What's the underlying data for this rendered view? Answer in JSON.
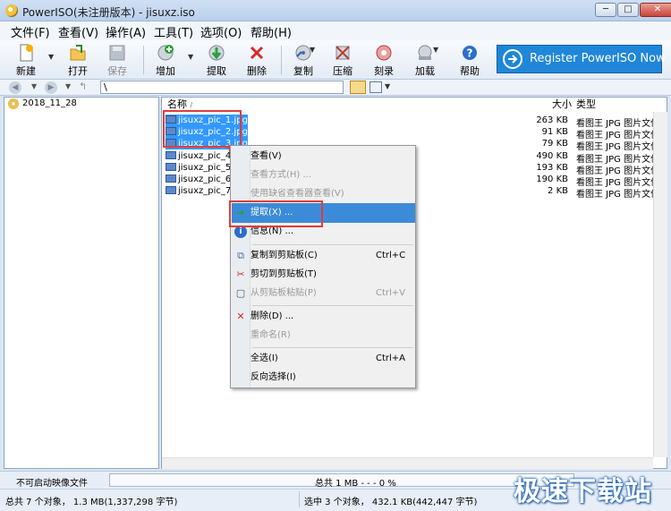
{
  "window": {
    "title": "PowerISO(未注册版本) - jisuxz.iso",
    "buttons": {
      "minimize": "─",
      "maximize": "□",
      "close": "✕"
    }
  },
  "menu": [
    "文件(F)",
    "查看(V)",
    "操作(A)",
    "工具(T)",
    "选项(O)",
    "帮助(H)"
  ],
  "toolbar": {
    "new": "新建",
    "open": "打开",
    "save": "保存",
    "add": "增加",
    "extract": "提取",
    "delete": "删除",
    "copy": "复制",
    "compress": "压缩",
    "burn": "刻录",
    "mount": "加载",
    "help": "帮助",
    "register": "Register PowerISO Now"
  },
  "address": {
    "path": "\\"
  },
  "tree": {
    "root": "2018_11_28"
  },
  "columns": {
    "name": "名称",
    "size": "大小",
    "type": "类型"
  },
  "files": [
    {
      "name": "jisuxz_pic_1.jpg",
      "size": "263 KB",
      "type": "看图王 JPG 图片文件",
      "selected": true
    },
    {
      "name": "jisuxz_pic_2.jpg",
      "size": "91 KB",
      "type": "看图王 JPG 图片文件",
      "selected": true
    },
    {
      "name": "jisuxz_pic_3.jpg",
      "size": "79 KB",
      "type": "看图王 JPG 图片文件",
      "selected": true
    },
    {
      "name": "jisuxz_pic_4.jpg",
      "size": "490 KB",
      "type": "看图王 JPG 图片文件",
      "selected": false
    },
    {
      "name": "jisuxz_pic_5.jpg",
      "size": "193 KB",
      "type": "看图王 JPG 图片文件",
      "selected": false
    },
    {
      "name": "jisuxz_pic_6.jpg",
      "size": "190 KB",
      "type": "看图王 JPG 图片文件",
      "selected": false
    },
    {
      "name": "jisuxz_pic_7.jpg",
      "size": "2 KB",
      "type": "看图王 JPG 图片文件",
      "selected": false
    }
  ],
  "context_menu": {
    "view": "查看(V)",
    "view_as": "查看方式(H) ...",
    "open_default": "使用缺省查看器查看(V)",
    "extract": "提取(X) ...",
    "info": "信息(N) ...",
    "copy_clip": "复制到剪贴板(C)",
    "copy_sc": "Ctrl+C",
    "cut_clip": "剪切到剪贴板(T)",
    "paste_clip": "从剪贴板粘贴(P)",
    "paste_sc": "Ctrl+V",
    "delete": "删除(D) ...",
    "rename": "重命名(R)",
    "select_all": "全选(I)",
    "select_all_sc": "Ctrl+A",
    "invert": "反向选择(I)"
  },
  "status": {
    "image_type": "不可启动映像文件",
    "total_size": "总共  1 MB   - - -  0 %",
    "total_objects": "总共 7 个对象， 1.3 MB(1,337,298 字节)",
    "selected_objects": "选中 3 个对象， 432.1 KB(442,447 字节)"
  },
  "watermark": "极速下载站"
}
